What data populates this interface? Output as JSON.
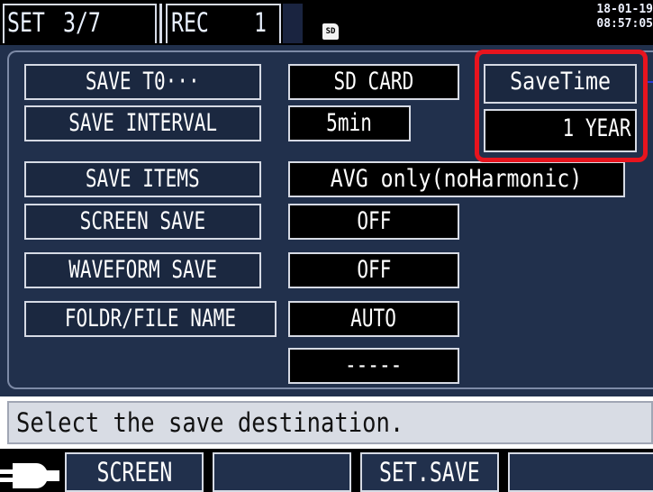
{
  "header": {
    "set_label": "SET",
    "set_page": "3/7",
    "rec_label": "REC",
    "rec_number": "1",
    "sd_label": "SD",
    "date": "18-01-19",
    "time": "08:57:05"
  },
  "settings": {
    "save_to": {
      "label": "SAVE T0···",
      "value": "SD CARD"
    },
    "save_interval": {
      "label": "SAVE INTERVAL",
      "value": "5min"
    },
    "save_items": {
      "label": "SAVE ITEMS",
      "value": "AVG only(noHarmonic)"
    },
    "screen_save": {
      "label": "SCREEN SAVE",
      "value": "OFF"
    },
    "waveform_save": {
      "label": "WAVEFORM SAVE",
      "value": "OFF"
    },
    "folder_file_name": {
      "label": "FOLDR/FILE NAME",
      "value": "AUTO"
    },
    "blank_value": "-----"
  },
  "save_time": {
    "label": "SaveTime",
    "value": "1 YEAR"
  },
  "message": "Select the save destination.",
  "function_bar": {
    "f1": "SCREEN",
    "f2": "",
    "f3": "SET.SAVE",
    "f4": ""
  },
  "colors": {
    "panel_bg": "#21304c",
    "highlight": "#e8141e",
    "message_bg": "#d8dce4"
  }
}
